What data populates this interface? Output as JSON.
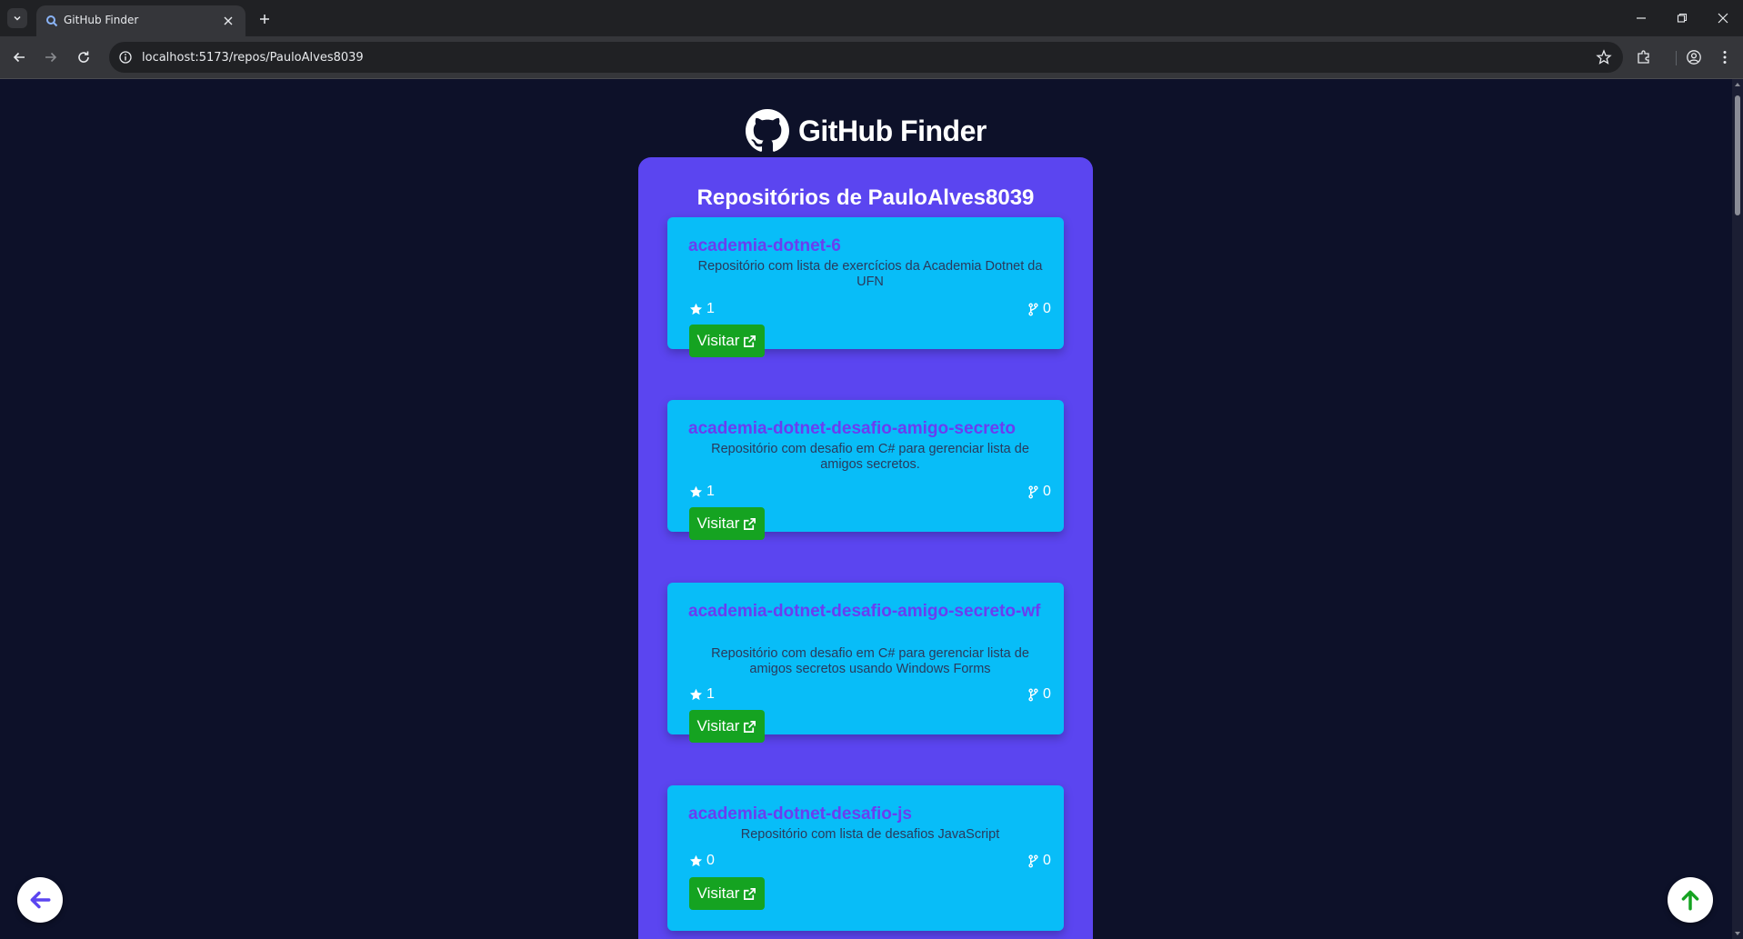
{
  "browser": {
    "tab_title": "GitHub Finder",
    "url": "localhost:5173/repos/PauloAlves8039"
  },
  "app": {
    "title": "GitHub Finder",
    "heading": "Repositórios de PauloAlves8039"
  },
  "repos": [
    {
      "name": "academia-dotnet-6",
      "description": "Repositório com lista de exercícios da Academia Dotnet da UFN",
      "stars": "1",
      "forks": "0",
      "visit_label": "Visitar"
    },
    {
      "name": "academia-dotnet-desafio-amigo-secreto",
      "description": "Repositório com desafio em C# para gerenciar lista de amigos secretos.",
      "stars": "1",
      "forks": "0",
      "visit_label": "Visitar"
    },
    {
      "name": "academia-dotnet-desafio-amigo-secreto-wf",
      "description": "Repositório com desafio em C# para gerenciar lista de amigos secretos usando Windows Forms",
      "stars": "1",
      "forks": "0",
      "visit_label": "Visitar"
    },
    {
      "name": "academia-dotnet-desafio-js",
      "description": "Repositório com lista de desafios JavaScript",
      "stars": "0",
      "forks": "0",
      "visit_label": "Visitar"
    }
  ],
  "colors": {
    "page_bg": "#0d1129",
    "panel_bg": "#5b45f0",
    "card_bg": "#08bdf8",
    "repo_name": "#6a3ef0",
    "visit_button": "#15a321",
    "back_arrow": "#5b45f0",
    "top_arrow": "#15a321"
  },
  "icons": {
    "logo": "github-icon",
    "star": "star-icon",
    "fork": "fork-icon",
    "external": "external-link-icon",
    "back": "arrow-left-icon",
    "top": "arrow-up-icon"
  }
}
